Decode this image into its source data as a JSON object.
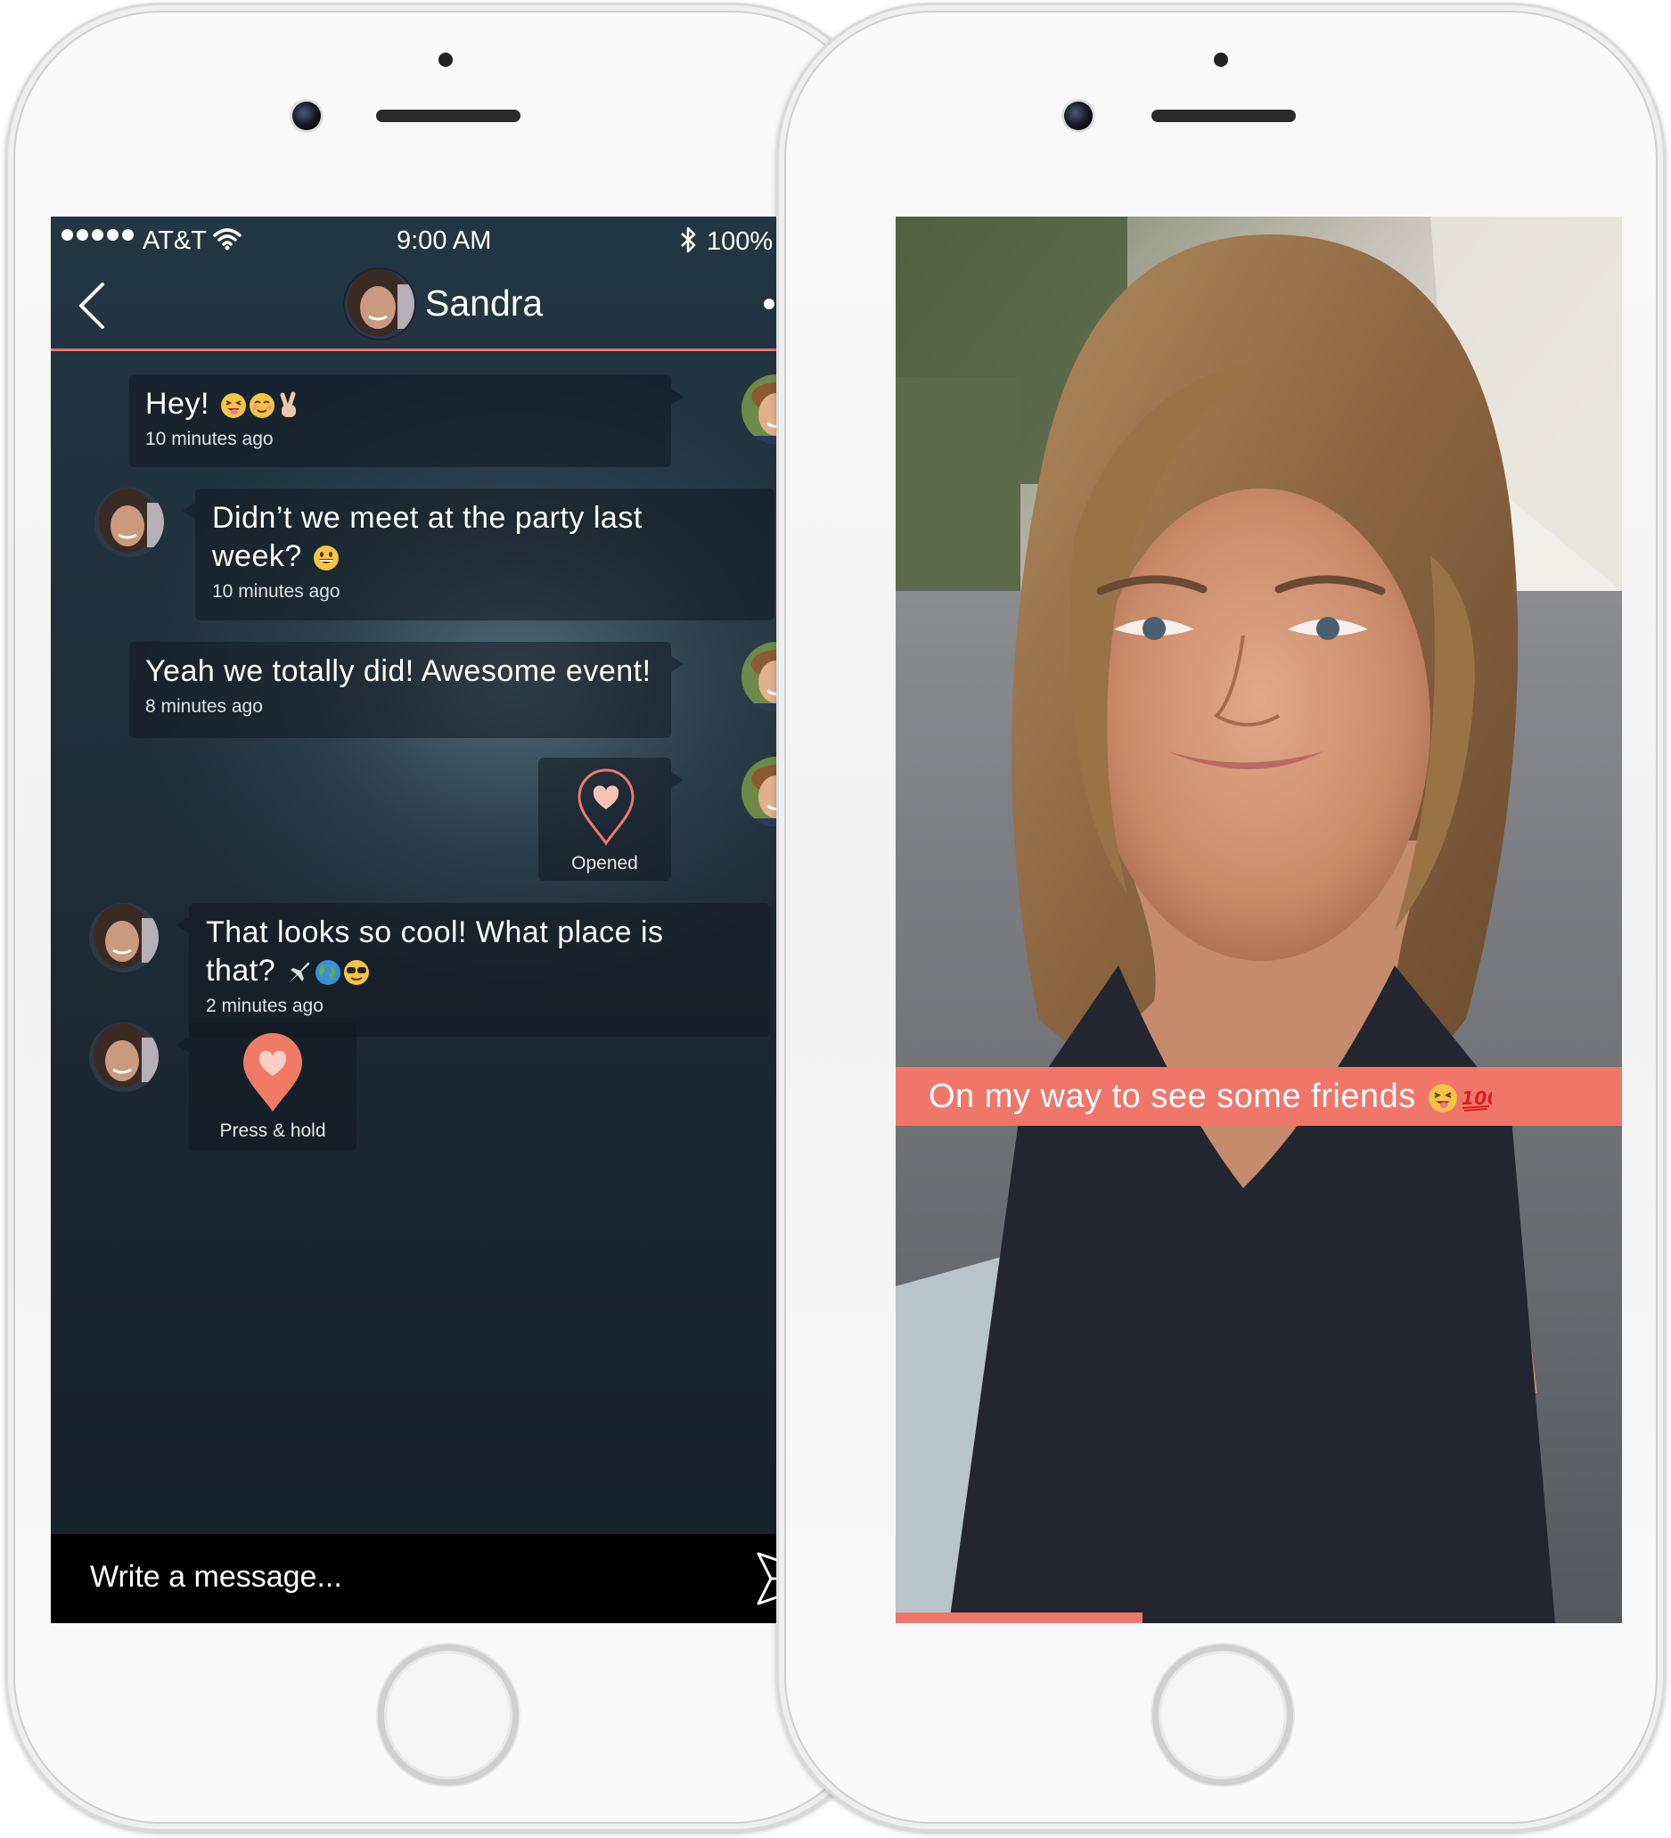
{
  "status_bar": {
    "carrier": "AT&T",
    "time": "9:00 AM",
    "battery": "100%"
  },
  "chat": {
    "contact_name": "Sandra",
    "messages": [
      {
        "sender": "me",
        "text": "Hey!",
        "time": "10 minutes ago"
      },
      {
        "sender": "contact",
        "text": "Didn’t we meet at the party last week?",
        "time": "10 minutes ago"
      },
      {
        "sender": "me",
        "text": "Yeah we totally did! Awesome event!",
        "time": "8 minutes ago"
      },
      {
        "sender": "me",
        "type": "heart",
        "label": "Opened"
      },
      {
        "sender": "contact",
        "text": "That looks so cool! What place is that?",
        "time": "2 minutes ago"
      },
      {
        "sender": "contact",
        "type": "heart",
        "label": "Press & hold"
      }
    ],
    "composer": {
      "placeholder": "Write a message..."
    }
  },
  "story": {
    "caption": "On my way to see some friends",
    "progress": 0.34
  },
  "colors": {
    "accent": "#f0766a",
    "chat_bg": "#1f2f3a",
    "composer_bg": "#000000"
  },
  "icons": [
    "back-chevron-icon",
    "more-dots-icon",
    "send-icon",
    "heart-pin-icon",
    "wifi-icon",
    "bluetooth-icon",
    "battery-icon",
    "signal-dots-icon"
  ]
}
